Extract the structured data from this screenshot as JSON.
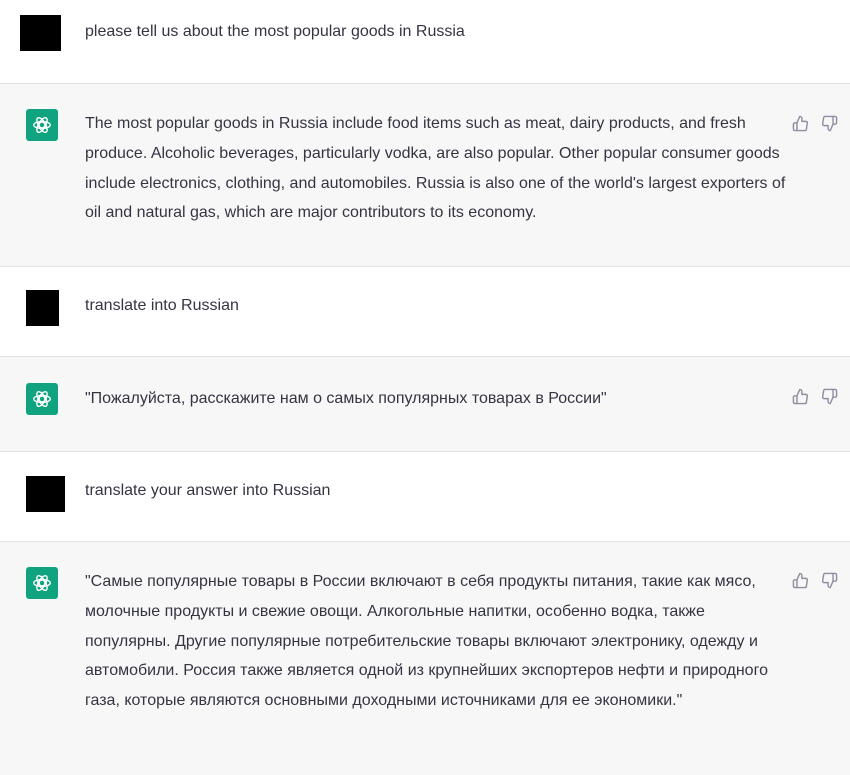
{
  "conversation": [
    {
      "role": "user",
      "text": "please tell us about the most popular goods in Russia"
    },
    {
      "role": "assistant",
      "text": "The most popular goods in Russia include food items such as meat, dairy products, and fresh produce. Alcoholic beverages, particularly vodka, are also popular. Other popular consumer goods include electronics, clothing, and automobiles. Russia is also one of the world's largest exporters of oil and natural gas, which are major contributors to its economy."
    },
    {
      "role": "user",
      "text": "translate into Russian"
    },
    {
      "role": "assistant",
      "text": "\"Пожалуйста, расскажите нам о самых популярных товарах в России\""
    },
    {
      "role": "user",
      "text": "translate your answer into Russian"
    },
    {
      "role": "assistant",
      "text": "\"Самые популярные товары в России включают в себя продукты питания, такие как мясо, молочные продукты и свежие овощи. Алкогольные напитки, особенно водка, также популярны. Другие популярные потребительские товары включают электронику, одежду и автомобили. Россия также является одной из крупнейших экспортеров нефти и природного газа, которые являются основными доходными источниками для ее экономики.\""
    }
  ],
  "icons": {
    "assistant_avatar": "openai-logo-icon",
    "like": "thumbs-up-icon",
    "dislike": "thumbs-down-icon"
  },
  "colors": {
    "assistant_avatar_bg": "#10a37f",
    "assistant_row_bg": "#f7f7f8",
    "user_row_bg": "#ffffff",
    "text": "#343541"
  }
}
